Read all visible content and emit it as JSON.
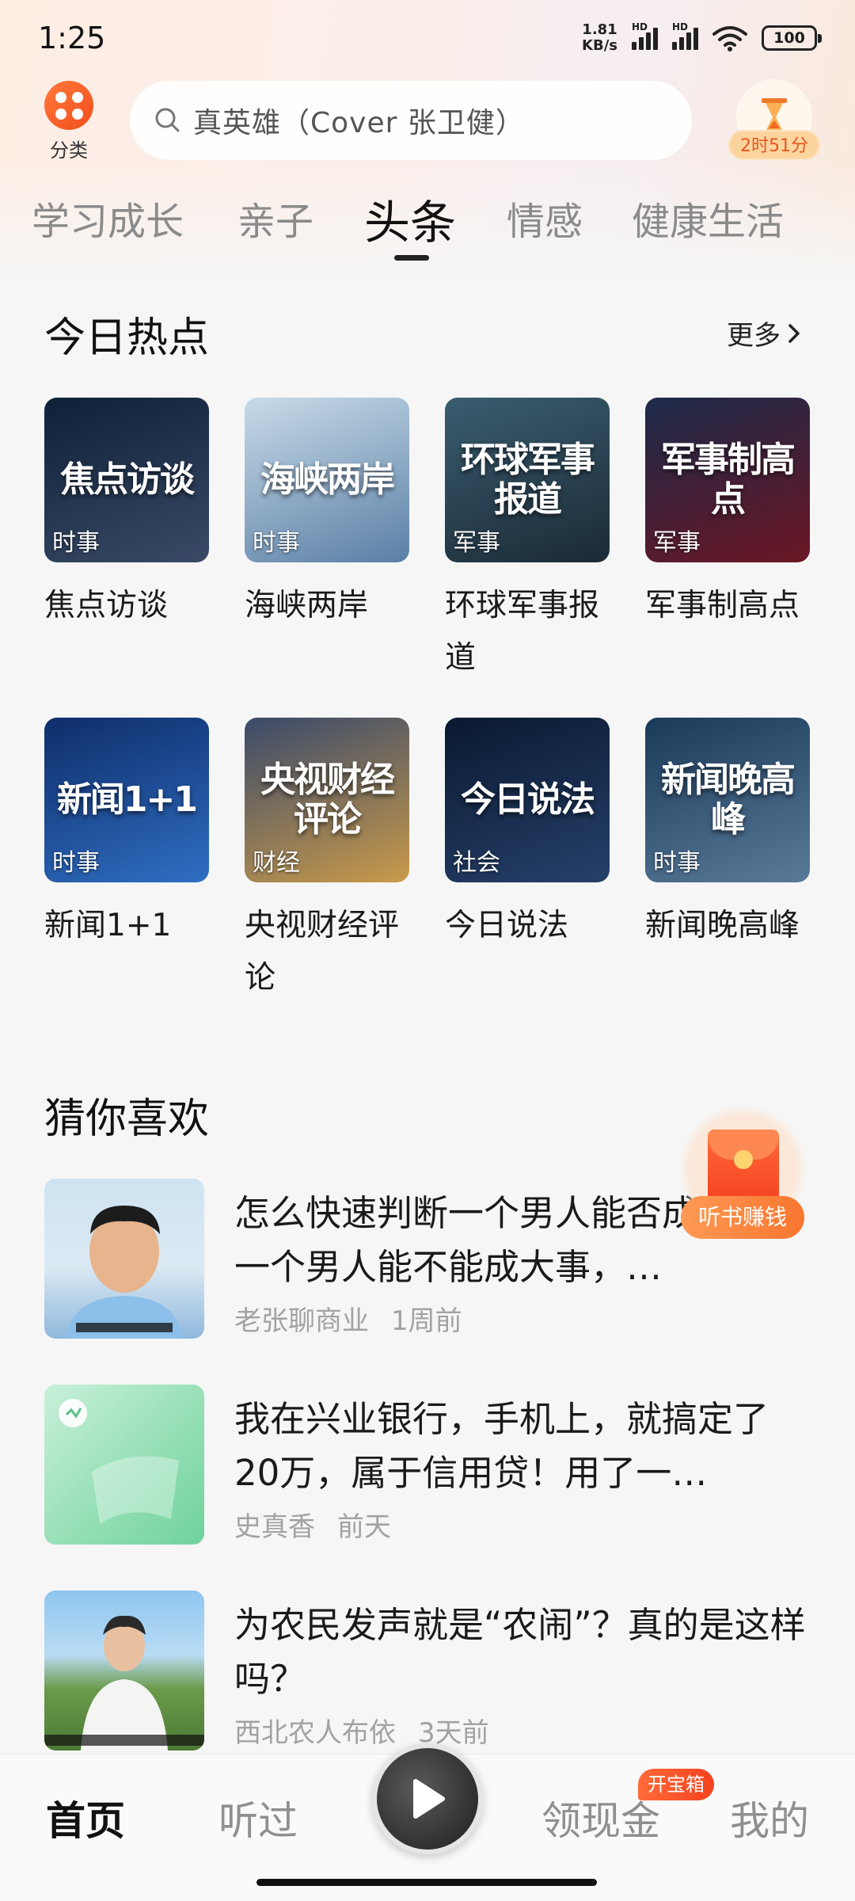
{
  "status_bar": {
    "time": "1:25",
    "net_speed_value": "1.81",
    "net_speed_unit": "KB/s",
    "hd_label": "HD",
    "battery": "100"
  },
  "header": {
    "category_label": "分类",
    "search_placeholder": "真英雄（Cover 张卫健）",
    "timer_label": "2时51分"
  },
  "tabs": [
    {
      "label": "学习成长",
      "active": false
    },
    {
      "label": "亲子",
      "active": false
    },
    {
      "label": "头条",
      "active": true
    },
    {
      "label": "情感",
      "active": false
    },
    {
      "label": "健康生活",
      "active": false
    }
  ],
  "hot_today": {
    "title": "今日热点",
    "more_label": "更多",
    "items": [
      {
        "thumb_title": "焦点访谈",
        "tag": "时事",
        "name": "焦点访谈",
        "colors": [
          "#0e2138",
          "#3a4a66"
        ]
      },
      {
        "thumb_title": "海峡两岸",
        "tag": "时事",
        "name": "海峡两岸",
        "colors": [
          "#c8dbe8",
          "#5a7fa6"
        ]
      },
      {
        "thumb_title": "环球军事报道",
        "tag": "军事",
        "name": "环球军事报道",
        "colors": [
          "#3a5d70",
          "#1b2a36"
        ]
      },
      {
        "thumb_title": "军事制高点",
        "tag": "军事",
        "name": "军事制高点",
        "colors": [
          "#1c2a4a",
          "#6b1624"
        ]
      },
      {
        "thumb_title": "新闻1+1",
        "tag": "时事",
        "name": "新闻1+1",
        "colors": [
          "#0f2d6a",
          "#2f6ec2"
        ]
      },
      {
        "thumb_title": "央视财经评论",
        "tag": "财经",
        "name": "央视财经评论",
        "colors": [
          "#3a4a6a",
          "#c99a4a"
        ]
      },
      {
        "thumb_title": "今日说法",
        "tag": "社会",
        "name": "今日说法",
        "colors": [
          "#0a1930",
          "#26406a"
        ]
      },
      {
        "thumb_title": "新闻晚高峰",
        "tag": "时事",
        "name": "新闻晚高峰",
        "colors": [
          "#1a3a5a",
          "#5a7a9a"
        ]
      }
    ]
  },
  "guess": {
    "title": "猜你喜欢",
    "items": [
      {
        "title": "怎么快速判断一个男人能否成大事？一个男人能不能成大事，…",
        "author": "老张聊商业",
        "time": "1周前"
      },
      {
        "title": "我在兴业银行，手机上，就搞定了20万，属于信用贷！用了一…",
        "author": "史真香",
        "time": "前天"
      },
      {
        "title": "为农民发声就是“农闹”？真的是这样吗？",
        "author": "西北农人布依",
        "time": "3天前"
      }
    ]
  },
  "floating": {
    "label": "听书赚钱"
  },
  "bottom_nav": {
    "home": "首页",
    "history": "听过",
    "cash": "领现金",
    "cash_badge": "开宝箱",
    "mine": "我的"
  }
}
